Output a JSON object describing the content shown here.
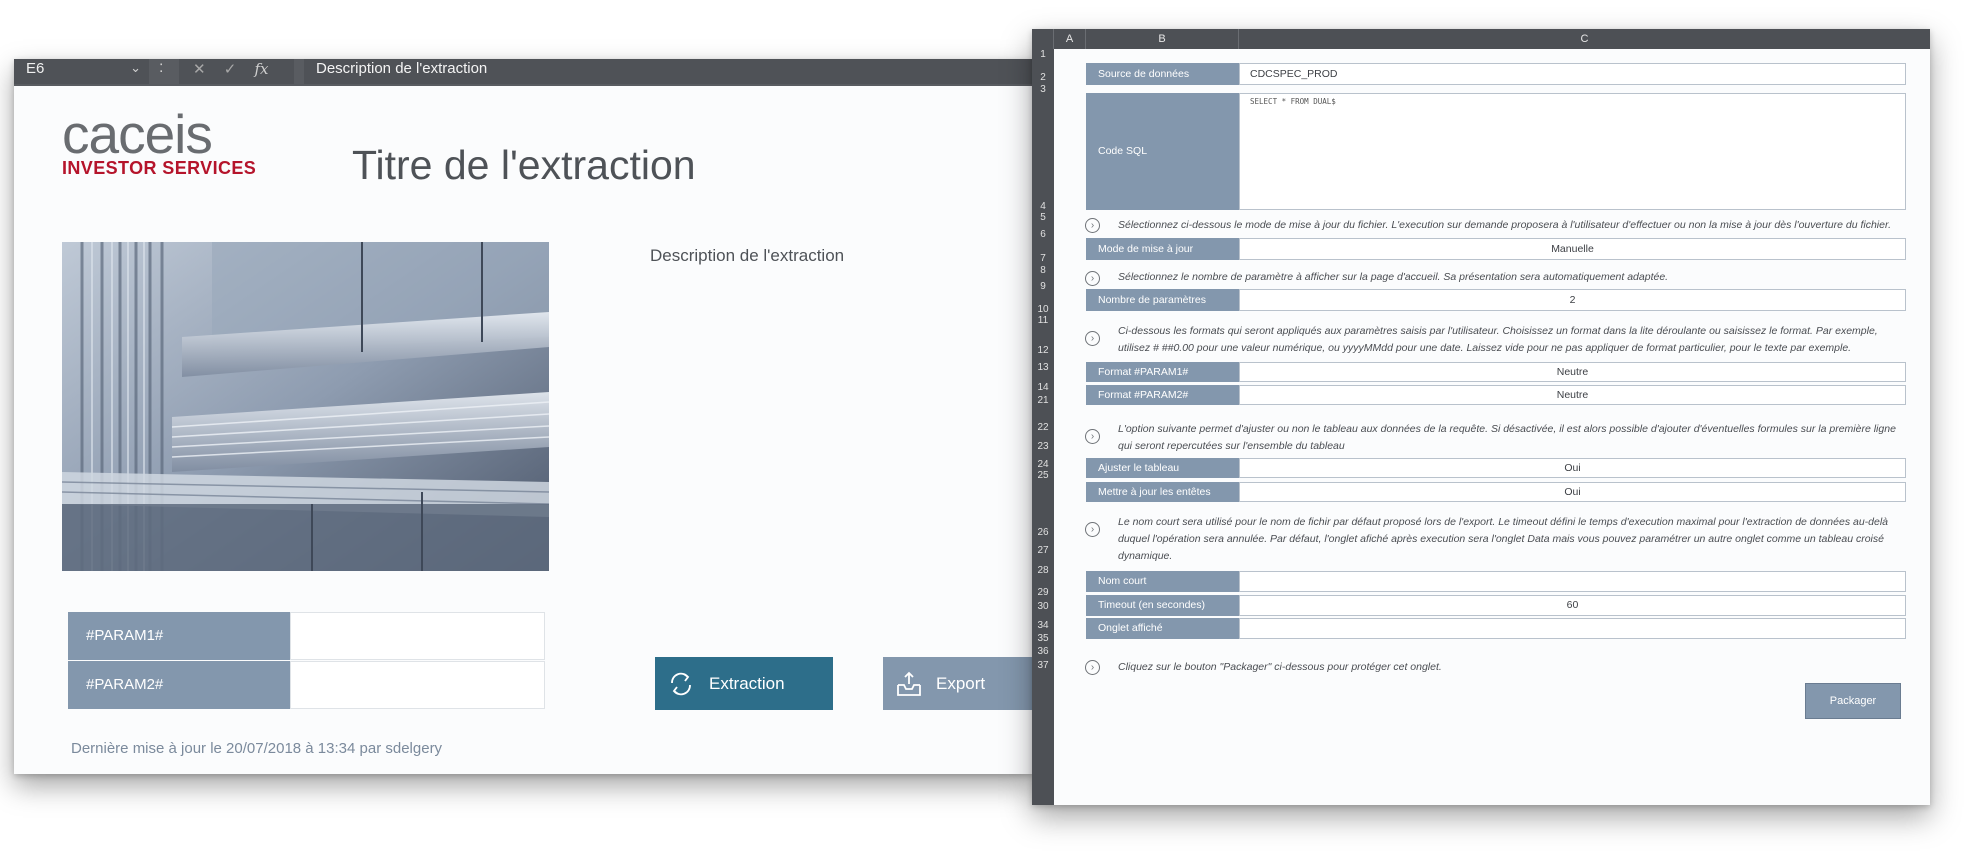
{
  "left_window": {
    "formula_bar": {
      "cell_ref": "E6",
      "separator": ":",
      "cancel_glyph": "✕",
      "confirm_glyph": "✓",
      "fx_glyph": "fx",
      "value": "Description de l'extraction"
    },
    "logo": {
      "name": "caceis",
      "tagline": "INVESTOR SERVICES"
    },
    "title": "Titre de l'extraction",
    "description": "Description de l'extraction",
    "params": [
      {
        "label": "#PARAM1#",
        "value": ""
      },
      {
        "label": "#PARAM2#",
        "value": ""
      }
    ],
    "buttons": {
      "extraction": "Extraction",
      "export": "Export"
    },
    "last_update": "Dernière mise à jour le 20/07/2018 à 13:34 par sdelgery"
  },
  "right_window": {
    "columns": [
      "A",
      "B",
      "C"
    ],
    "row_numbers": [
      "1",
      "2",
      "3",
      "4",
      "5",
      "6",
      "7",
      "8",
      "9",
      "10",
      "11",
      "12",
      "13",
      "14",
      "21",
      "22",
      "23",
      "24",
      "25",
      "26",
      "27",
      "28",
      "29",
      "30",
      "34",
      "35",
      "36",
      "37"
    ],
    "source": {
      "label": "Source de données",
      "value": "CDCSPEC_PROD"
    },
    "sql": {
      "label": "Code SQL",
      "value": "SELECT * FROM DUAL$"
    },
    "note_mode": "Sélectionnez ci-dessous le mode de mise à jour du fichier. L'execution sur demande proposera à l'utilisateur d'effectuer ou non la mise à jour dès l'ouverture du fichier.",
    "mode": {
      "label": "Mode de mise à jour",
      "value": "Manuelle"
    },
    "note_params": "Sélectionnez le nombre de paramètre à afficher sur la page d'accueil. Sa présentation sera automatiquement adaptée.",
    "nb_params": {
      "label": "Nombre de paramètres",
      "value": "2"
    },
    "note_formats_1": "Ci-dessous les formats qui seront appliqués aux paramètres saisis par l'utilisateur. Choisissez un format dans la lite déroulante ou saisissez le format. Par exemple,",
    "note_formats_2": "utilisez # ##0.00 pour une valeur numérique, ou yyyyMMdd pour une date. Laissez vide pour ne pas appliquer de format particulier, pour le texte par exemple.",
    "format1": {
      "label": "Format #PARAM1#",
      "value": "Neutre"
    },
    "format2": {
      "label": "Format #PARAM2#",
      "value": "Neutre"
    },
    "note_table_1": "L'option suivante permet d'ajuster ou non le tableau aux données de la requête. Si désactivée, il est alors possible d'ajouter d'éventuelles formules sur la première ligne",
    "note_table_2": "qui seront repercutées sur l'ensemble du tableau",
    "adjust": {
      "label": "Ajuster le tableau",
      "value": "Oui"
    },
    "headers": {
      "label": "Mettre à jour les entêtes",
      "value": "Oui"
    },
    "note_short_1": "Le nom court sera utilisé pour le nom de fichir par défaut proposé lors de l'export. Le timeout défini le temps d'execution maximal pour l'extraction de données au-delà",
    "note_short_2": "duquel l'opération sera annulée. Par défaut, l'onglet afiché après execution sera l'onglet Data mais vous pouvez paramétrer un autre onglet comme un tableau croisé",
    "note_short_3": "dynamique.",
    "short_name": {
      "label": "Nom court",
      "value": ""
    },
    "timeout": {
      "label": "Timeout (en secondes)",
      "value": "60"
    },
    "tab_shown": {
      "label": "Onglet affiché",
      "value": ""
    },
    "note_packager": "Cliquez sur le bouton \"Packager\" ci-dessous pour protéger cet onglet.",
    "packager_button": "Packager",
    "arrow_glyph": "›"
  },
  "colors": {
    "label_bg": "#8397ad",
    "extraction_btn": "#2d6e8a",
    "brand_red": "#b5142b",
    "header_dark": "#4d5055"
  },
  "icons": [
    "chevron-down-icon",
    "cancel-icon",
    "confirm-icon",
    "fx-icon",
    "refresh-icon",
    "export-tray-icon",
    "circle-arrow-icon"
  ]
}
